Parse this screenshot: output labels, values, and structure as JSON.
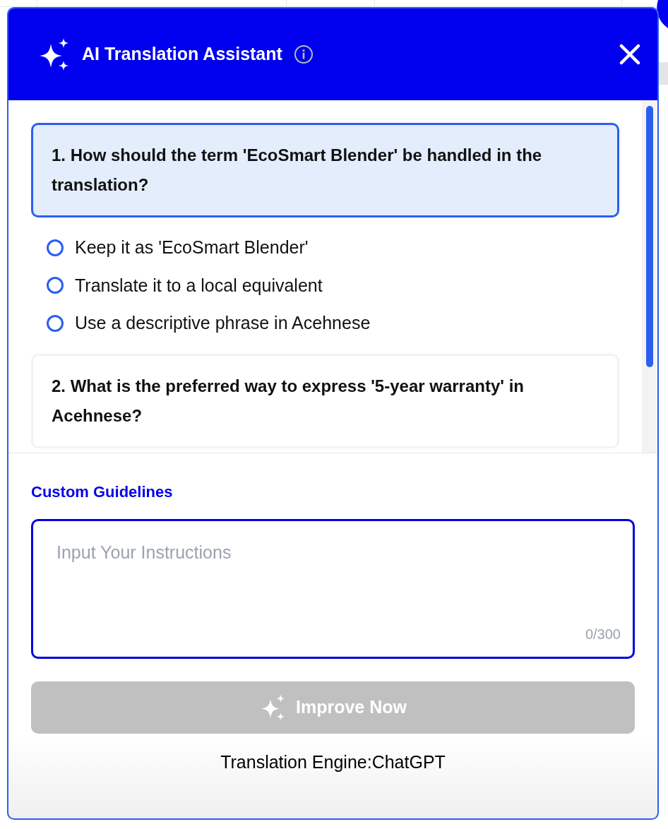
{
  "panel": {
    "title": "AI Translation Assistant"
  },
  "questions": [
    {
      "text": "1. How should the term 'EcoSmart Blender' be handled in the translation?",
      "selected": true,
      "options": [
        {
          "label": "Keep it as 'EcoSmart Blender'",
          "selected": false
        },
        {
          "label": "Translate it to a local equivalent",
          "selected": false
        },
        {
          "label": "Use a descriptive phrase in Acehnese",
          "selected": false
        }
      ]
    },
    {
      "text": "2. What is the preferred way to express '5-year warranty' in Acehnese?",
      "selected": false
    }
  ],
  "guidelines": {
    "heading": "Custom Guidelines",
    "placeholder": "Input Your Instructions",
    "counter": "0/300"
  },
  "submit": {
    "label": "Improve Now",
    "disabled": true
  },
  "footer": "Translation Engine:ChatGPT"
}
